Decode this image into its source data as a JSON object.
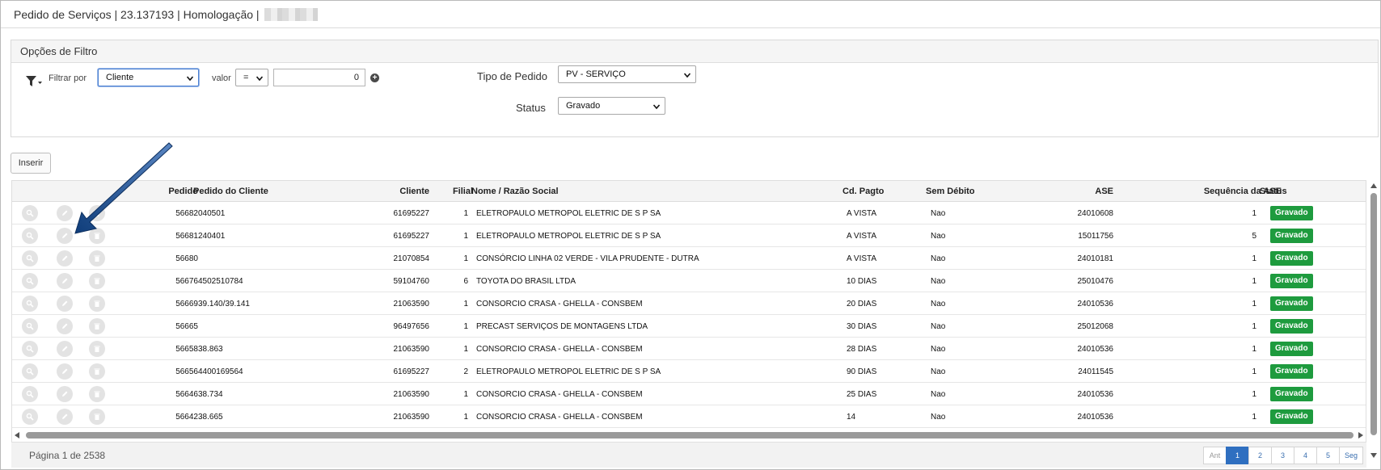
{
  "window": {
    "title": "Pedido de Serviços | 23.137193 | Homologação | "
  },
  "filter": {
    "panel_title": "Opções de Filtro",
    "filter_by_label": "Filtrar por",
    "filter_by_value": "Cliente",
    "valor_label": "valor",
    "operator_value": "=",
    "value_input": "0",
    "tipo_pedido_label": "Tipo de Pedido",
    "tipo_pedido_value": "PV - SERVIÇO",
    "status_label": "Status",
    "status_value": "Gravado"
  },
  "toolbar": {
    "insert_label": "Inserir"
  },
  "table": {
    "headers": {
      "pedido": "Pedido",
      "pedido_cliente": "Pedido do Cliente",
      "cliente": "Cliente",
      "filial": "Filial",
      "nome": "Nome / Razão Social",
      "cd_pagto": "Cd. Pagto",
      "sem_debito": "Sem Débito",
      "ase": "ASE",
      "seq_ase": "Sequência da ASE",
      "status": "Status"
    },
    "rows": [
      {
        "pedido": "56682",
        "pedido_cliente": "040501",
        "cliente": "61695227",
        "filial": "1",
        "nome": "ELETROPAULO METROPOL ELETRIC DE S P SA",
        "cd_pagto": "A VISTA",
        "sem_debito": "Nao",
        "ase": "24010608",
        "seq_ase": "1",
        "status": "Gravado"
      },
      {
        "pedido": "56681",
        "pedido_cliente": "240401",
        "cliente": "61695227",
        "filial": "1",
        "nome": "ELETROPAULO METROPOL ELETRIC DE S P SA",
        "cd_pagto": "A VISTA",
        "sem_debito": "Nao",
        "ase": "15011756",
        "seq_ase": "5",
        "status": "Gravado"
      },
      {
        "pedido": "56680",
        "pedido_cliente": "",
        "cliente": "21070854",
        "filial": "1",
        "nome": "CONSÓRCIO LINHA 02 VERDE - VILA PRUDENTE - DUTRA",
        "cd_pagto": "A VISTA",
        "sem_debito": "Nao",
        "ase": "24010181",
        "seq_ase": "1",
        "status": "Gravado"
      },
      {
        "pedido": "56676",
        "pedido_cliente": "4502510784",
        "cliente": "59104760",
        "filial": "6",
        "nome": "TOYOTA DO BRASIL LTDA",
        "cd_pagto": "10 DIAS",
        "sem_debito": "Nao",
        "ase": "25010476",
        "seq_ase": "1",
        "status": "Gravado"
      },
      {
        "pedido": "56669",
        "pedido_cliente": "39.140/39.141",
        "cliente": "21063590",
        "filial": "1",
        "nome": "CONSORCIO CRASA - GHELLA - CONSBEM",
        "cd_pagto": "20 DIAS",
        "sem_debito": "Nao",
        "ase": "24010536",
        "seq_ase": "1",
        "status": "Gravado"
      },
      {
        "pedido": "56665",
        "pedido_cliente": "",
        "cliente": "96497656",
        "filial": "1",
        "nome": "PRECAST SERVIÇOS DE MONTAGENS LTDA",
        "cd_pagto": "30 DIAS",
        "sem_debito": "Nao",
        "ase": "25012068",
        "seq_ase": "1",
        "status": "Gravado"
      },
      {
        "pedido": "56658",
        "pedido_cliente": "38.863",
        "cliente": "21063590",
        "filial": "1",
        "nome": "CONSORCIO CRASA - GHELLA - CONSBEM",
        "cd_pagto": "28 DIAS",
        "sem_debito": "Nao",
        "ase": "24010536",
        "seq_ase": "1",
        "status": "Gravado"
      },
      {
        "pedido": "56656",
        "pedido_cliente": "4400169564",
        "cliente": "61695227",
        "filial": "2",
        "nome": "ELETROPAULO METROPOL ELETRIC DE S P SA",
        "cd_pagto": "90 DIAS",
        "sem_debito": "Nao",
        "ase": "24011545",
        "seq_ase": "1",
        "status": "Gravado"
      },
      {
        "pedido": "56646",
        "pedido_cliente": "38.734",
        "cliente": "21063590",
        "filial": "1",
        "nome": "CONSORCIO CRASA - GHELLA - CONSBEM",
        "cd_pagto": "25 DIAS",
        "sem_debito": "Nao",
        "ase": "24010536",
        "seq_ase": "1",
        "status": "Gravado"
      },
      {
        "pedido": "56642",
        "pedido_cliente": "38.665",
        "cliente": "21063590",
        "filial": "1",
        "nome": "CONSORCIO CRASA - GHELLA - CONSBEM",
        "cd_pagto": "14",
        "sem_debito": "Nao",
        "ase": "24010536",
        "seq_ase": "1",
        "status": "Gravado"
      }
    ]
  },
  "footer": {
    "page_info": "Página 1 de 2538",
    "pages": [
      "Ant",
      "1",
      "2",
      "3",
      "4",
      "5",
      "Seg"
    ],
    "active_page": "1"
  },
  "colors": {
    "status_badge": "#1e9b3e",
    "pager_active": "#2f6fc0",
    "annotation_arrow": "#1f4f8f"
  }
}
